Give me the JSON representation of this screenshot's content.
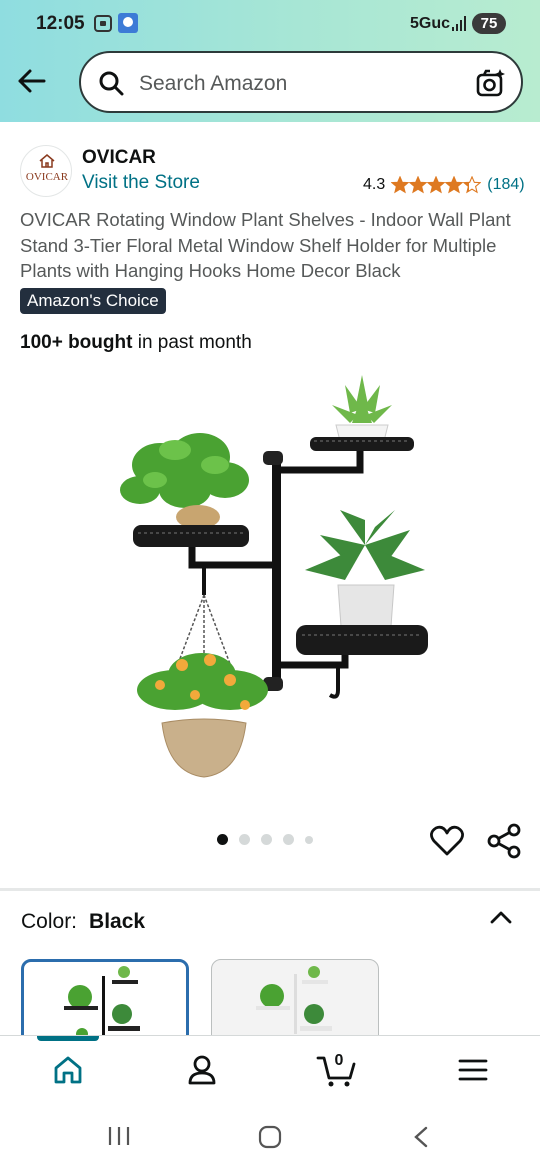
{
  "status_bar": {
    "time": "12:05",
    "network": "5Guc",
    "battery": "75"
  },
  "search": {
    "placeholder": "Search Amazon"
  },
  "seller": {
    "logo_text": "OVICAR",
    "name": "OVICAR",
    "store_link": "Visit the Store"
  },
  "rating": {
    "value": "4.3",
    "count": "(184)",
    "stars": 4.3
  },
  "product": {
    "title": "OVICAR Rotating Window Plant Shelves - Indoor Wall Plant Stand 3-Tier Floral Metal Window Shelf Holder for Multiple Plants with Hanging Hooks Home Decor Black",
    "badge": "Amazon's Choice",
    "bought_bold": "100+ bought",
    "bought_rest": " in past month"
  },
  "gallery": {
    "image_count": 5,
    "current_index": 1
  },
  "color": {
    "label": "Color:",
    "selected": "Black"
  },
  "cart": {
    "count": "0"
  },
  "colors": {
    "accent": "#007185",
    "badge_bg": "#232f3e",
    "star": "#de7921",
    "selected_border": "#2b6dad"
  }
}
